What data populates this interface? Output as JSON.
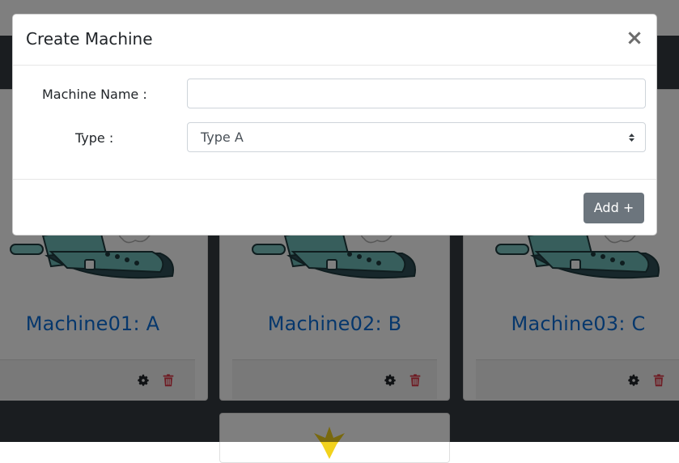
{
  "modal": {
    "title": "Create Machine",
    "close_label": "×",
    "fields": {
      "name_label": "Machine Name :",
      "name_value": "",
      "name_placeholder": "",
      "type_label": "Type :",
      "type_value": "Type A"
    },
    "add_button": "Add +"
  },
  "cards": [
    {
      "title": "Machine01: A"
    },
    {
      "title": "Machine02: B"
    },
    {
      "title": "Machine03: C"
    }
  ],
  "colors": {
    "navbar": "#343a40",
    "card_title": "#0d6fd8",
    "delete_icon": "#dc3545",
    "add_button": "#6c757d"
  },
  "icons": {
    "card_actions": [
      "gear-icon",
      "trash-icon"
    ],
    "card_image": "robot-machine-illustration"
  }
}
